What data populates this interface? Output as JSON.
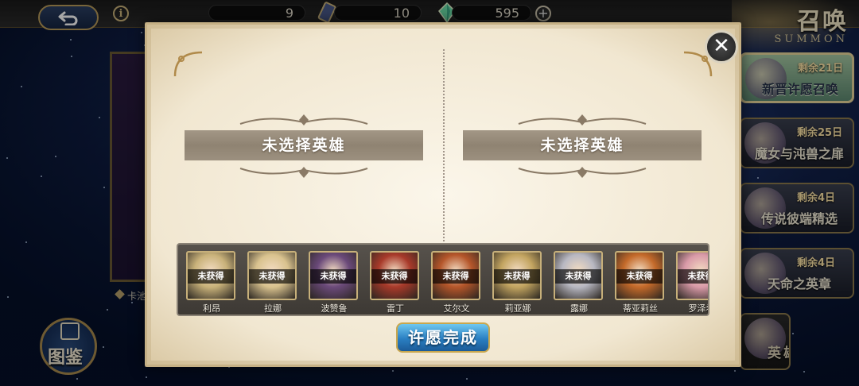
{
  "topbar": {
    "resource_1": "9",
    "resource_2": "10",
    "resource_3": "595",
    "title": "召唤",
    "title_en": "SUMMON"
  },
  "left": {
    "panel_label": "卡池",
    "book_label": "图鉴"
  },
  "banners": [
    {
      "remain": "剩余21日",
      "name": "新晋许愿召唤",
      "active": true
    },
    {
      "remain": "剩余25日",
      "name": "魔女与沌兽之扉",
      "active": false
    },
    {
      "remain": "剩余4日",
      "name": "传说彼端精选",
      "active": false
    },
    {
      "remain": "剩余4日",
      "name": "天命之英章",
      "active": false
    },
    {
      "remain": "",
      "name": "英雄召唤",
      "active": false
    }
  ],
  "modal": {
    "left_slot": "未选择英雄",
    "right_slot": "未选择英雄",
    "locked_text": "未获得",
    "heroes": [
      {
        "name": "利昂",
        "color": "#c9b27a"
      },
      {
        "name": "拉娜",
        "color": "#d9c28e"
      },
      {
        "name": "波赞鲁",
        "color": "#6b4a7a"
      },
      {
        "name": "雷丁",
        "color": "#a83a2a"
      },
      {
        "name": "艾尔文",
        "color": "#b5562a"
      },
      {
        "name": "莉亚娜",
        "color": "#c2a460"
      },
      {
        "name": "露娜",
        "color": "#b8b8c2"
      },
      {
        "name": "蒂亚莉丝",
        "color": "#c46a2a"
      },
      {
        "name": "罗泽希",
        "color": "#d99aa8"
      }
    ],
    "confirm_label": "许愿完成",
    "close_label": "✕"
  }
}
